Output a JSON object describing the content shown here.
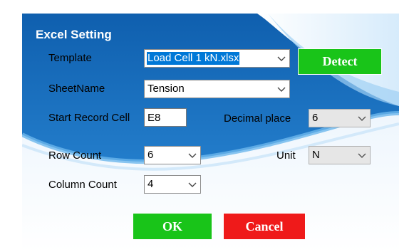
{
  "dialog": {
    "title": "Excel Setting"
  },
  "fields": {
    "template_label": "Template",
    "template_value": "Load Cell 1 kN.xlsx",
    "sheetname_label": "SheetName",
    "sheetname_value": "Tension",
    "start_record_label": "Start Record Cell",
    "start_record_value": "E8",
    "decimal_label": "Decimal place",
    "decimal_value": "6",
    "row_count_label": "Row Count",
    "row_count_value": "6",
    "unit_label": "Unit",
    "unit_value": "N",
    "column_count_label": "Column Count",
    "column_count_value": "4"
  },
  "buttons": {
    "detect": "Detect",
    "ok": "OK",
    "cancel": "Cancel"
  },
  "colors": {
    "panel_blue": "#1a74c4",
    "detect_green": "#19c419",
    "ok_green": "#19c419",
    "cancel_red": "#ef1a1a",
    "selection_blue": "#0078d7"
  }
}
